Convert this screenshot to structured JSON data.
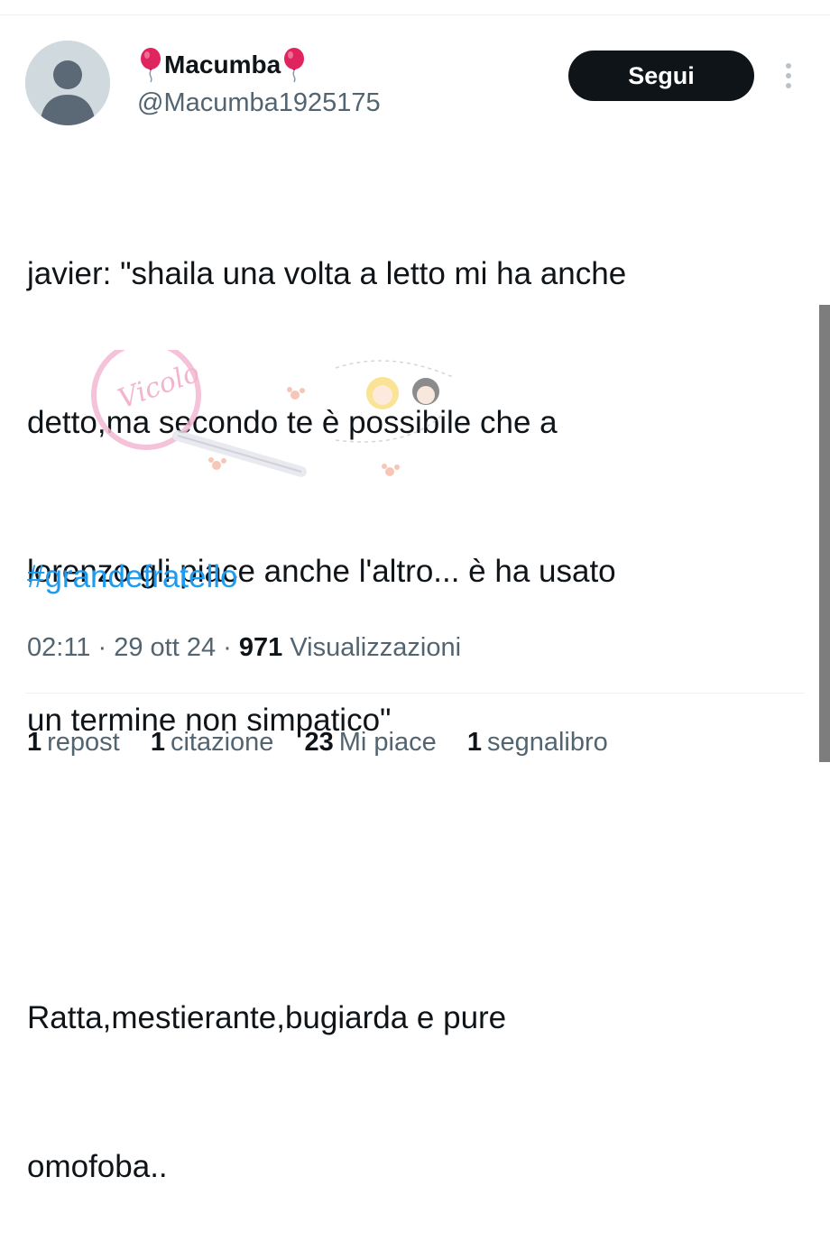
{
  "user": {
    "display_name": "Macumba",
    "handle": "@Macumba1925175",
    "name_emoji": "balloon-icon"
  },
  "actions": {
    "follow_label": "Segui",
    "more_icon": "more-vertical-icon"
  },
  "tweet": {
    "lines": [
      "javier: \"shaila una volta a letto mi ha anche",
      "detto,ma secondo te è possibile che a",
      "lorenzo gli piace anche l'altro... è ha usato",
      "un termine non simpatico\"",
      "Ratta,mestierante,bugiarda e pure",
      "omofoba.."
    ],
    "hashtag": "#grandefratello"
  },
  "meta": {
    "time": "02:11",
    "separator": "·",
    "date": "29 ott 24",
    "views_count": "971",
    "views_label": "Visualizzazioni"
  },
  "stats": {
    "reposts_count": "1",
    "reposts_label": "repost",
    "quotes_count": "1",
    "quotes_label": "citazione",
    "likes_count": "23",
    "likes_label": "Mi piace",
    "bookmarks_count": "1",
    "bookmarks_label": "segnalibro"
  },
  "colors": {
    "hashtag": "#1d9bf0",
    "follow_bg": "#0f1419",
    "secondary_text": "#536471",
    "balloon": "#e0245e"
  },
  "watermark": {
    "text": "Vicolo"
  }
}
